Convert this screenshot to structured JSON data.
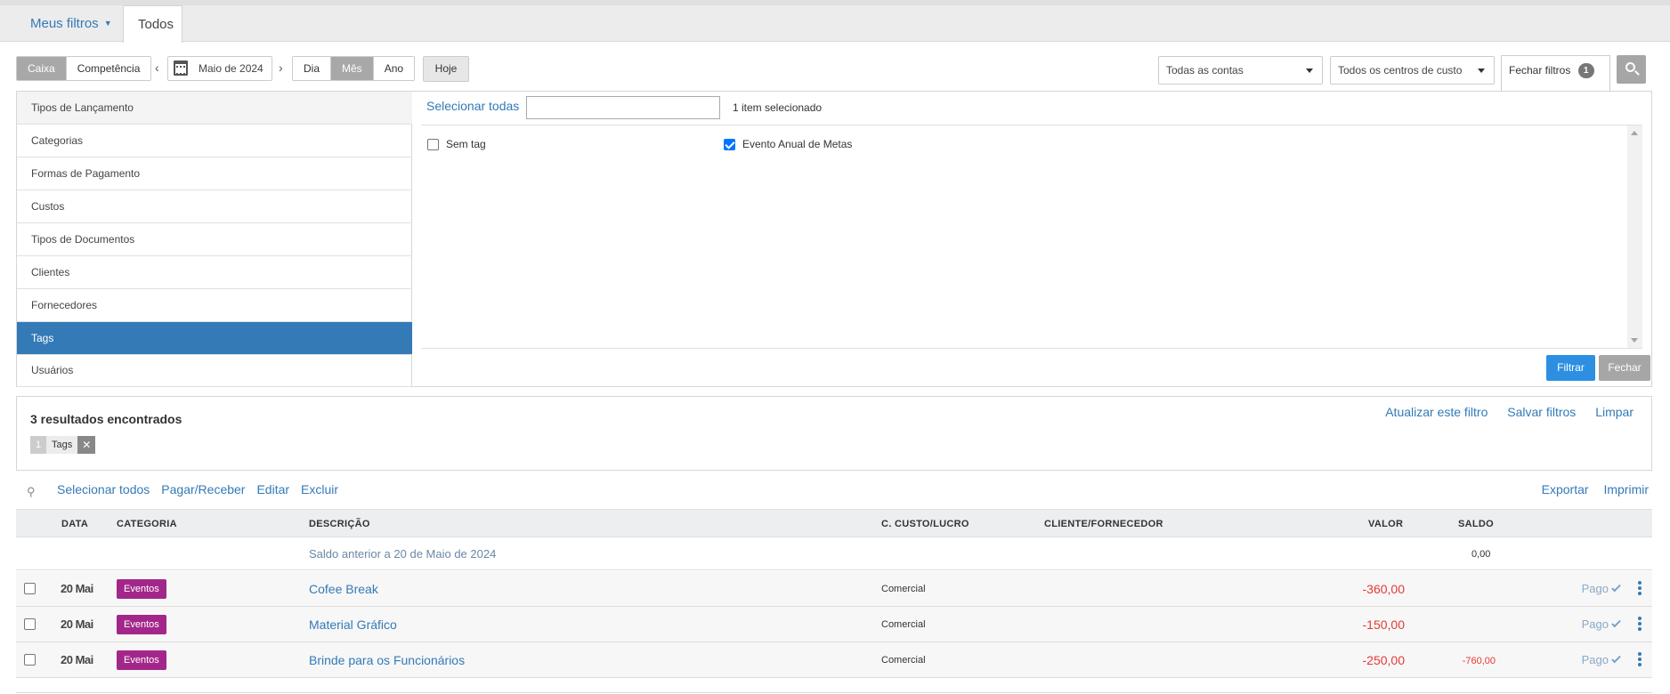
{
  "tabs": {
    "meus_filtros": "Meus filtros",
    "todos": "Todos"
  },
  "toolbar": {
    "regime": [
      "Caixa",
      "Competência"
    ],
    "period": "Maio de 2024",
    "granularity": [
      "Dia",
      "Mês",
      "Ano"
    ],
    "today": "Hoje",
    "accounts_select": "Todas as contas",
    "cost_center_select": "Todos os centros de custo",
    "close_filters": "Fechar filtros",
    "filter_count": "1"
  },
  "filter_menu": {
    "items": [
      "Tipos de Lançamento",
      "Categorias",
      "Formas de Pagamento",
      "Custos",
      "Tipos de Documentos",
      "Clientes",
      "Fornecedores",
      "Tags",
      "Usuários"
    ],
    "active": "Tags"
  },
  "tag_panel": {
    "select_all": "Selecionar todas",
    "search_value": "",
    "selected_count": "1 item selecionado",
    "options": [
      {
        "label": "Sem tag",
        "checked": false
      },
      {
        "label": "Evento Anual de Metas",
        "checked": true
      }
    ],
    "filter_button": "Filtrar",
    "close_button": "Fechar"
  },
  "results": {
    "title": "3 resultados encontrados",
    "links": [
      "Atualizar este filtro",
      "Salvar filtros",
      "Limpar"
    ],
    "chip": {
      "count": "1",
      "label": "Tags",
      "remove": "✕"
    }
  },
  "actions": {
    "left": [
      "Selecionar todos",
      "Pagar/Receber",
      "Editar",
      "Excluir"
    ],
    "right": [
      "Exportar",
      "Imprimir"
    ]
  },
  "table": {
    "headers": {
      "date": "DATA",
      "category": "CATEGORIA",
      "description": "DESCRIÇÃO",
      "cost_center": "C. CUSTO/LUCRO",
      "client": "CLIENTE/FORNECEDOR",
      "value": "VALOR",
      "balance": "SALDO"
    },
    "previous_balance": {
      "label": "Saldo anterior a 20 de Maio de 2024",
      "value": "0,00"
    },
    "rows": [
      {
        "date": "20 Mai",
        "category": "Eventos",
        "description": "Cofee Break",
        "cost_center": "Comercial",
        "client": "",
        "value": "-360,00",
        "balance": "",
        "status": "Pago"
      },
      {
        "date": "20 Mai",
        "category": "Eventos",
        "description": "Material Gráfico",
        "cost_center": "Comercial",
        "client": "",
        "value": "-150,00",
        "balance": "",
        "status": "Pago"
      },
      {
        "date": "20 Mai",
        "category": "Eventos",
        "description": "Brinde para os Funcionários",
        "cost_center": "Comercial",
        "client": "",
        "value": "-250,00",
        "balance": "-760,00",
        "status": "Pago"
      }
    ]
  },
  "colors": {
    "accent": "#337ab7",
    "category_badge": "#a3278a",
    "negative": "#e53935",
    "filter_button": "#2d8fe2"
  }
}
